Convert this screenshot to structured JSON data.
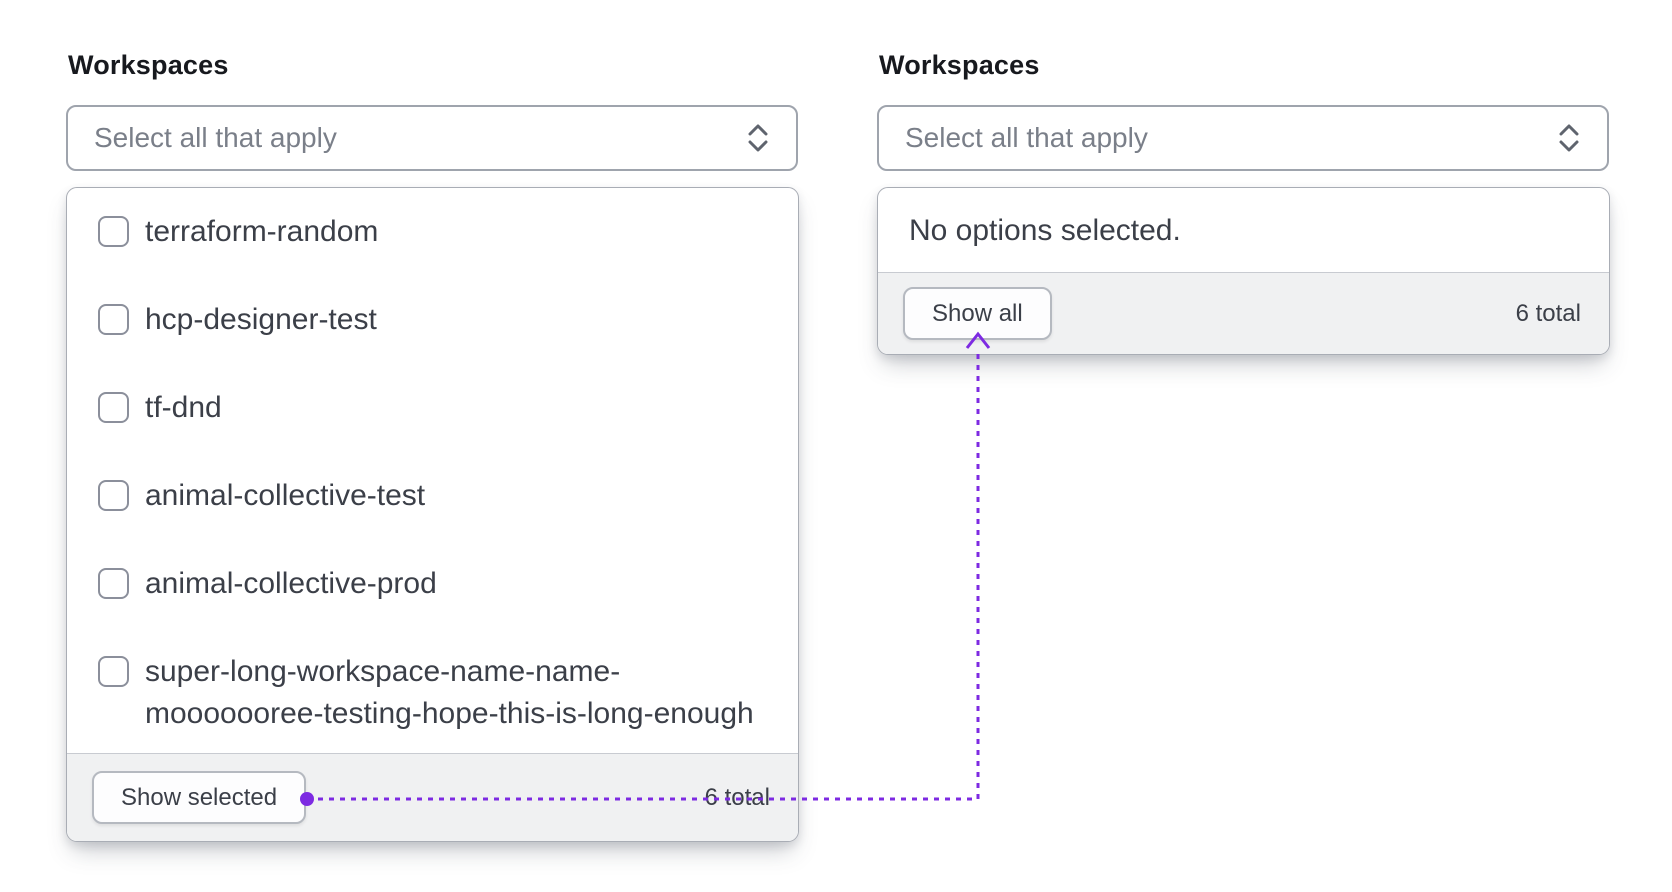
{
  "left_combobox": {
    "label": "Workspaces",
    "placeholder": "Select all that apply",
    "options": [
      {
        "label": "terraform-random",
        "checked": false
      },
      {
        "label": "hcp-designer-test",
        "checked": false
      },
      {
        "label": "tf-dnd",
        "checked": false
      },
      {
        "label": "animal-collective-test",
        "checked": false
      },
      {
        "label": "animal-collective-prod",
        "checked": false
      },
      {
        "label": "super-long-workspace-name-name-mooooooree-testing-hope-this-is-long-enough",
        "checked": false
      }
    ],
    "footer": {
      "button": "Show selected",
      "total": "6 total"
    }
  },
  "right_combobox": {
    "label": "Workspaces",
    "placeholder": "Select all that apply",
    "empty_message": "No options selected.",
    "footer": {
      "button": "Show all",
      "total": "6 total"
    }
  },
  "annotation": {
    "color": "#7d2ae2"
  },
  "colors": {
    "heading_text": "#17191e",
    "body_text": "#3b3f48",
    "placeholder_text": "#7a7f89",
    "border": "#9fa4ad",
    "footer_background": "#f0f1f2",
    "accent_purple": "#7d2ae2"
  }
}
